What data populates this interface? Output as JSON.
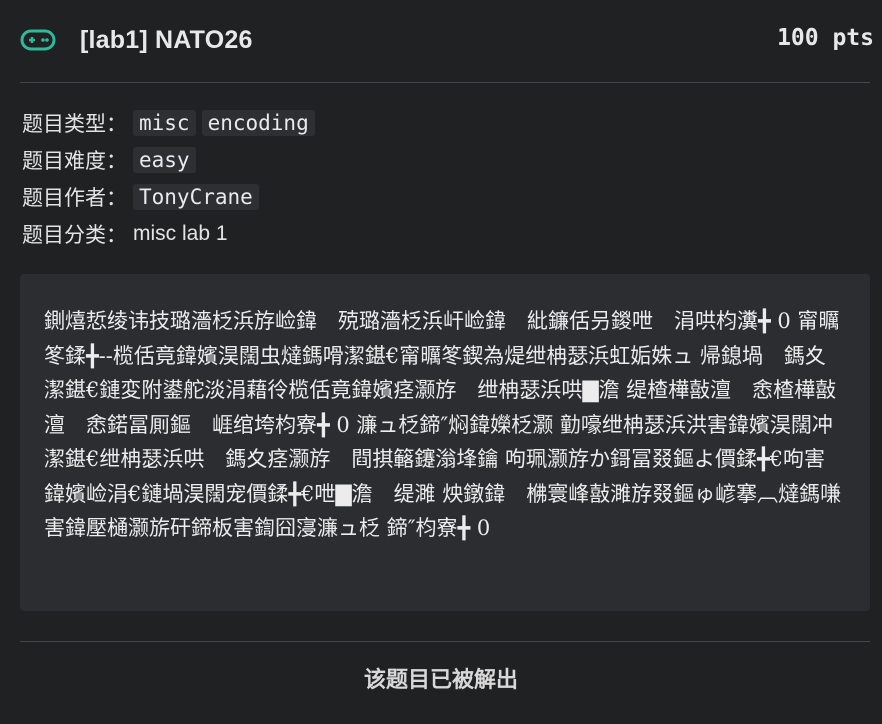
{
  "challenge": {
    "title": "[lab1] NATO26",
    "points": "100 pts",
    "icon": "gamepad-icon",
    "accent_color": "#2fb89a"
  },
  "meta": {
    "type_label": "题目类型：",
    "type_tags": [
      "misc",
      "encoding"
    ],
    "difficulty_label": "题目难度：",
    "difficulty": "easy",
    "author_label": "题目作者：",
    "author": "TonyCrane",
    "category_label": "题目分类：",
    "category": "misc lab 1"
  },
  "description": "鍘熺悊绫讳技璐濇柉浜斿崄鍏　殑璐濇柉浜屽崄鍏　紕鐮佸叧鍐呭　涓哄枃瀵╋ 0 甯曞笗鍒╋--榄佸竟鍏嬪淏闊虫燵鎷嗗潔鍖€甯曞笗鍥為煶绁柟瑟浜虹姤姝ュ 帰鎴堝　鎷夊潔鍖€鏈変附鍙舵淡涓藉彾榄佸竟鍏嬪痉灏斿　绁柟瑟浜哄▇澹 缇楂樺敼澶　悆楂樺敼澶　悆鍩冨厠鏂　崕绾垮枃寮╋ 0 濂ュ柉鍗″焖鍏嬫柉灏 勭嚎绁柟瑟浜洪害鍏嬪淏闊冲潔鍖€绁柟瑟浜哄　鎷夊痉灏斿　閰掑簵鑳滃埄鑰 呴珮灏斿か鎶冨叕鏂よ價鍒╋€呴害鍏嬪崄涓€鏈堝淏闊宠價鍒╋€呭▇澹　缇濉 炴鐓鍏　梻寰峰敼濉斿叕鏂ゅ嵃搴︹燵鎷嗛害鍏壓樋灏旂矸鍗板害鍧囧寖濂ュ柉 鍗″枃寮╋ 0",
  "status": {
    "solved_text": "该题目已被解出"
  }
}
